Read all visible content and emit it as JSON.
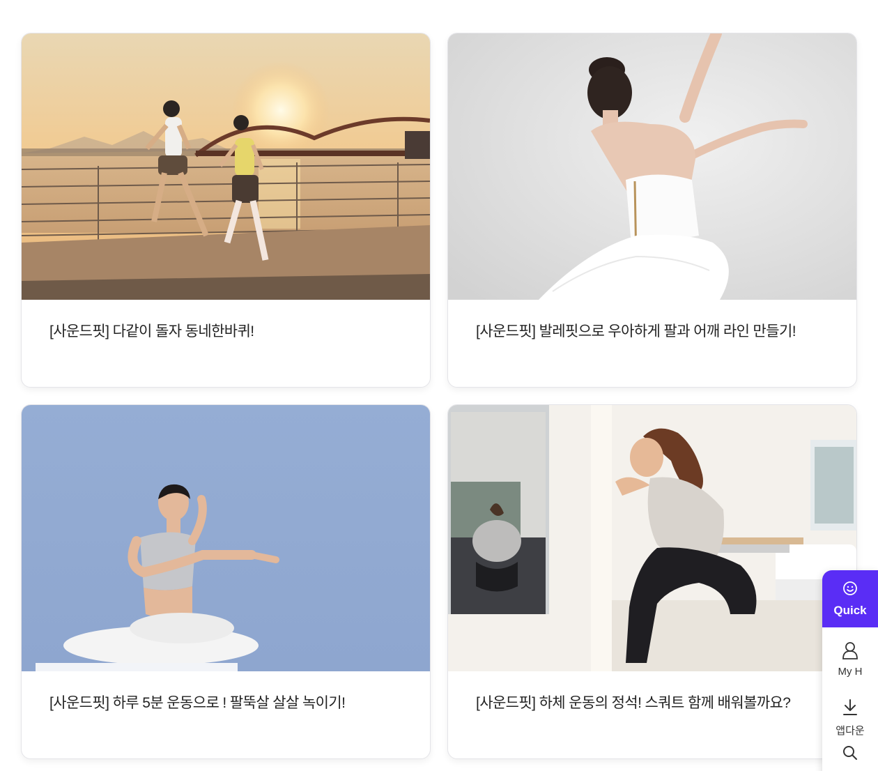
{
  "cards": [
    {
      "title": "[사운드핏] 다같이 돌자 동네한바퀴!",
      "image": "running-by-river-photo"
    },
    {
      "title": "[사운드핏] 발레핏으로 우아하게 팔과 어깨 라인 만들기!",
      "image": "ballet-dancer-photo"
    },
    {
      "title": "[사운드핏] 하루 5분 운동으로 ! 팔뚝살 살살 녹이기!",
      "image": "yoga-stretch-photo"
    },
    {
      "title": "[사운드핏] 하체 운동의 정석! 스쿼트 함께 배워볼까요?",
      "image": "squat-mirror-photo"
    }
  ],
  "quick_menu": {
    "title": "Quick",
    "items": [
      {
        "label": "My H",
        "icon": "user-icon"
      },
      {
        "label": "앱다운",
        "icon": "download-icon"
      },
      {
        "label": "",
        "icon": "search-icon"
      }
    ]
  },
  "colors": {
    "accent": "#5a2df5",
    "text": "#222222"
  }
}
